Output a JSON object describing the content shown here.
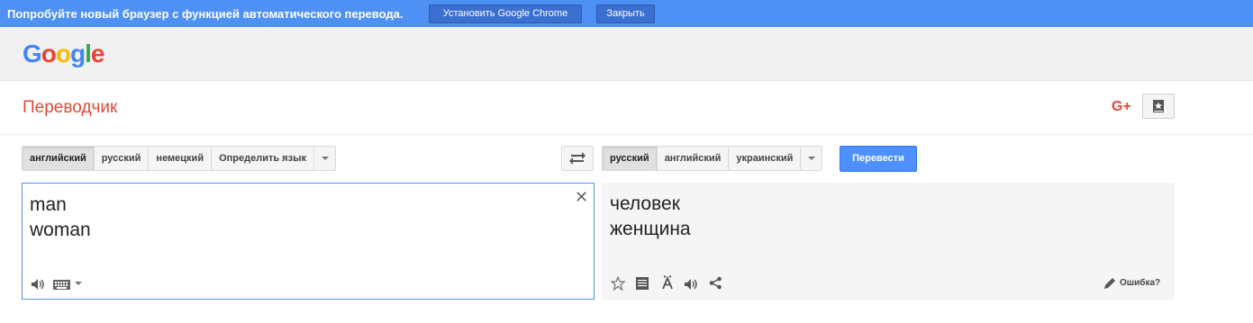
{
  "promo": {
    "text": "Попробуйте новый браузер с функцией автоматического перевода.",
    "install_label": "Установить Google Chrome",
    "close_label": "Закрыть"
  },
  "header": {
    "logo": [
      "G",
      "o",
      "o",
      "g",
      "l",
      "e"
    ],
    "logo_colors": [
      "#4285f4",
      "#ea4335",
      "#fbbc05",
      "#4285f4",
      "#34a853",
      "#ea4335"
    ]
  },
  "app": {
    "title": "Переводчик",
    "gplus": "G+"
  },
  "source": {
    "languages": [
      "английский",
      "русский",
      "немецкий",
      "Определить язык"
    ],
    "active_index": 0,
    "text": "man\nwoman"
  },
  "target": {
    "languages": [
      "русский",
      "английский",
      "украинский"
    ],
    "active_index": 0,
    "text": "человек\nженщина",
    "translate_label": "Перевести",
    "wrong_label": "Ошибка?"
  },
  "colors": {
    "promo_bg": "#4e90f4",
    "accent": "#4d90fe",
    "title_red": "#dd4b39"
  },
  "icons": {
    "source_tools": [
      "speaker-icon",
      "keyboard-icon",
      "chevron-down-icon"
    ],
    "result_tools": [
      "star-icon",
      "list-icon",
      "font-icon",
      "speaker-icon",
      "share-icon",
      "pencil-icon"
    ]
  }
}
